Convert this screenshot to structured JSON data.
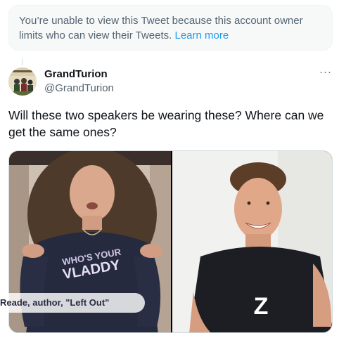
{
  "notice": {
    "text": "You’re unable to view this Tweet because this account owner limits who can view their Tweets.",
    "link_label": "Learn more"
  },
  "tweet": {
    "author_name": "GrandTurion",
    "author_handle": "@GrandTurion",
    "more_label": "···",
    "text": "Will these two speakers be wearing these? Where can we get the same ones?"
  },
  "media": {
    "left_caption": "Reade, author, \"Left Out\"",
    "shirt_text_line1": "WHO'S YOUR",
    "shirt_text_line2": "VLADDY",
    "shirt_letter": "Z"
  },
  "colors": {
    "link": "#1d9bf0",
    "secondary_text": "#536471",
    "notice_bg": "#f7f9f9"
  }
}
